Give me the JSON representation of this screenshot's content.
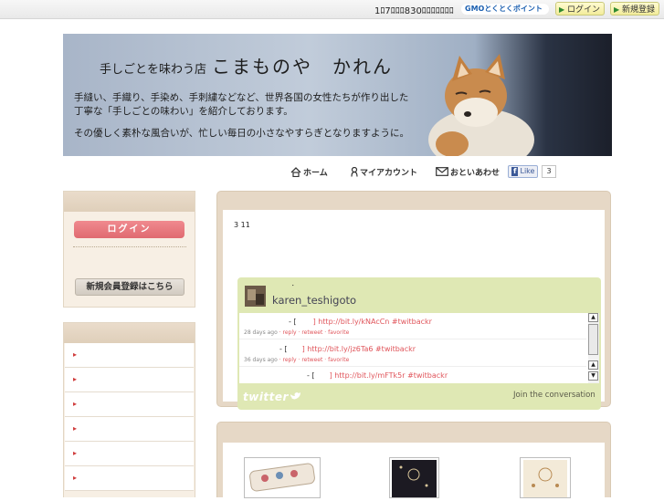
{
  "topbar": {
    "notice": "1ﾛ7ﾛﾛﾛ830ﾛﾛﾛﾛﾛﾛﾛ",
    "gmo_text": "GMOとくとくポイント",
    "login_label": "ログイン",
    "register_label": "新規登録"
  },
  "banner": {
    "title_small": "手しごとを味わう店",
    "title_big": "こまものや　かれん",
    "desc_line1": "手縫い、手織り、手染め、手刺繍などなど、世界各国の女性たちが作り出した",
    "desc_line2": "丁寧な「手しごとの味わい」を紹介しております。",
    "desc_line3": "その優しく素朴な風合いが、忙しい毎日の小さなやすらぎとなりますように。"
  },
  "nav": {
    "home": "ホーム",
    "account": "マイアカウント",
    "contact": "おといあわせ",
    "like": "Like",
    "like_count": "3"
  },
  "sidebar": {
    "login_button": "ログイン",
    "register_button": "新規会員登録はこちら",
    "menu_items": [
      "▸",
      "▸",
      "▸",
      "▸",
      "▸",
      "▸"
    ]
  },
  "main": {
    "post_text": "3 11"
  },
  "twitter": {
    "dot": "･",
    "username": "karen_teshigoto",
    "tweets": [
      {
        "prefix": "- [",
        "link": "] http://bit.ly/kNAcCn #twitbackr",
        "time": "28 days ago",
        "reply": "reply",
        "retweet": "retweet",
        "favorite": "favorite"
      },
      {
        "prefix": "- [",
        "link": "] http://bit.ly/jz6Ta6 #twitbackr",
        "time": "36 days ago",
        "reply": "reply",
        "retweet": "retweet",
        "favorite": "favorite"
      },
      {
        "prefix": "- [",
        "link": "] http://bit.ly/mFTk5r #twitbackr"
      }
    ],
    "logo": "twitter",
    "join": "Join the conversation",
    "scroll_up": "▲",
    "scroll_down": "▼"
  },
  "colors": {
    "accent_red": "#e0555b",
    "panel_beige": "#e6d8c6",
    "twitter_green": "#dfe8b4"
  }
}
